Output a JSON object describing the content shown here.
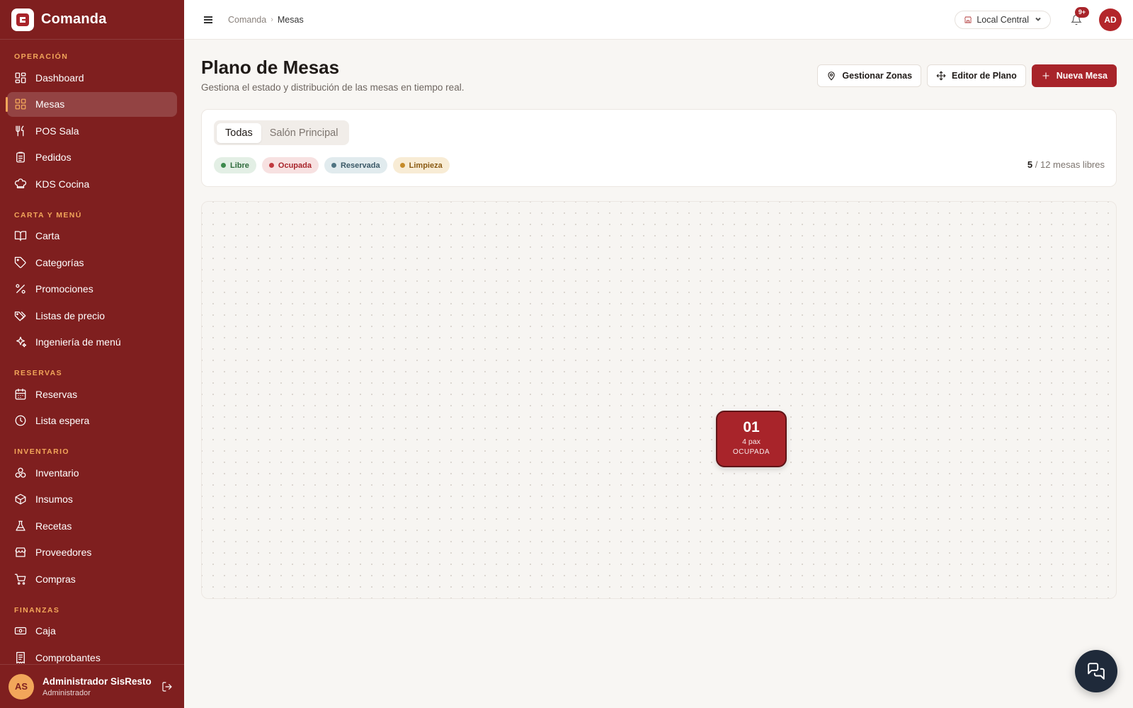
{
  "brand": {
    "name": "Comanda",
    "logo_icon": "brand-logo-icon"
  },
  "sidebar": {
    "sections": [
      {
        "title": "OPERACIÓN",
        "items": [
          {
            "label": "Dashboard",
            "icon": "dashboard-icon"
          },
          {
            "label": "Mesas",
            "icon": "grid-icon",
            "active": true
          },
          {
            "label": "POS Sala",
            "icon": "utensils-icon"
          },
          {
            "label": "Pedidos",
            "icon": "clipboard-icon"
          },
          {
            "label": "KDS Cocina",
            "icon": "chef-hat-icon"
          }
        ]
      },
      {
        "title": "CARTA Y MENÚ",
        "items": [
          {
            "label": "Carta",
            "icon": "book-open-icon"
          },
          {
            "label": "Categorías",
            "icon": "tag-icon"
          },
          {
            "label": "Promociones",
            "icon": "percent-icon"
          },
          {
            "label": "Listas de precio",
            "icon": "tags-icon"
          },
          {
            "label": "Ingeniería de menú",
            "icon": "sparkles-icon"
          }
        ]
      },
      {
        "title": "RESERVAS",
        "items": [
          {
            "label": "Reservas",
            "icon": "calendar-icon"
          },
          {
            "label": "Lista espera",
            "icon": "clock-icon"
          }
        ]
      },
      {
        "title": "INVENTARIO",
        "items": [
          {
            "label": "Inventario",
            "icon": "boxes-icon"
          },
          {
            "label": "Insumos",
            "icon": "package-icon"
          },
          {
            "label": "Recetas",
            "icon": "flask-icon"
          },
          {
            "label": "Proveedores",
            "icon": "store-icon"
          },
          {
            "label": "Compras",
            "icon": "cart-icon"
          }
        ]
      },
      {
        "title": "FINANZAS",
        "items": [
          {
            "label": "Caja",
            "icon": "banknote-icon"
          },
          {
            "label": "Comprobantes",
            "icon": "receipt-icon"
          }
        ]
      }
    ],
    "user": {
      "initials": "AS",
      "name": "Administrador SisResto",
      "role": "Administrador"
    }
  },
  "topbar": {
    "breadcrumb": {
      "root": "Comanda",
      "current": "Mesas"
    },
    "location": "Local Central",
    "notifications_badge": "9+",
    "avatar_initials": "AD"
  },
  "page": {
    "title": "Plano de Mesas",
    "subtitle": "Gestiona el estado y distribución de las mesas en tiempo real.",
    "actions": {
      "zones": "Gestionar Zonas",
      "editor": "Editor de Plano",
      "new_table": "Nueva Mesa"
    }
  },
  "filters": {
    "tabs": [
      {
        "label": "Todas",
        "active": true
      },
      {
        "label": "Salón Principal",
        "active": false
      }
    ],
    "legend": [
      {
        "label": "Libre",
        "bg": "#e3efe5",
        "color": "#2f6b3c",
        "dot": "#3d8a4d"
      },
      {
        "label": "Ocupada",
        "bg": "#f7e1e1",
        "color": "#a8242a",
        "dot": "#c0393f"
      },
      {
        "label": "Reservada",
        "bg": "#e1ebee",
        "color": "#3a5866",
        "dot": "#4f7482"
      },
      {
        "label": "Limpieza",
        "bg": "#f8ecd5",
        "color": "#8a5a12",
        "dot": "#c58b2a"
      }
    ],
    "count": {
      "free": "5",
      "total": "/ 12 mesas libres"
    }
  },
  "floor": {
    "tables": [
      {
        "number": "01",
        "pax": "4 pax",
        "status": "OCUPADA"
      }
    ]
  },
  "colors": {
    "sidebar": "#7f1f1f",
    "accent": "#a8242a",
    "section": "#f2a65a"
  }
}
